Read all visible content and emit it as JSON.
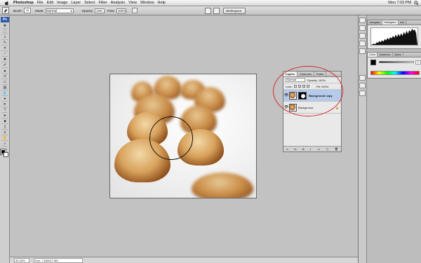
{
  "menubar": {
    "app": "Photoshop",
    "items": [
      "File",
      "Edit",
      "Image",
      "Layer",
      "Select",
      "Filter",
      "Analysis",
      "View",
      "Window",
      "Help"
    ],
    "clock": "Mon 7:03 PM"
  },
  "options": {
    "brush_label": "Brush:",
    "brush_size": "15",
    "mode_label": "Mode:",
    "mode_value": "Normal",
    "opacity_label": "Opacity:",
    "opacity_value": "13%",
    "flow_label": "Flow:",
    "flow_value": "100%",
    "workspace_label": "Workspace"
  },
  "toolbox": {
    "logo": "Ps",
    "tools": [
      "move",
      "marquee",
      "lasso",
      "quick-select",
      "crop",
      "slice",
      "heal",
      "brush",
      "stamp",
      "history",
      "eraser",
      "gradient",
      "blur",
      "dodge",
      "pen",
      "type",
      "path-select",
      "shape",
      "notes",
      "eyedropper",
      "hand",
      "zoom"
    ]
  },
  "layers": {
    "tabs": [
      "Layers",
      "Channels",
      "Paths"
    ],
    "blend_mode": "Normal",
    "opacity_label": "Opacity: 100%",
    "lock_label": "Lock:",
    "fill_label": "Fill: 100%",
    "rows": [
      {
        "name": "Background copy",
        "selected": true
      },
      {
        "name": "Background",
        "selected": false
      }
    ]
  },
  "dock": {
    "panel1_tabs": [
      "Navigator",
      "Histogram",
      "Info"
    ],
    "panel2_tabs": [
      "Color",
      "Swatches",
      "Styles"
    ],
    "k_value": "0"
  },
  "status": {
    "zoom": "33.33%",
    "docsize": "Doc: 7.64M/17.8M"
  },
  "colors": {
    "highlight_ring": "#d4272a",
    "workspace_bg": "#c2c2c2"
  }
}
